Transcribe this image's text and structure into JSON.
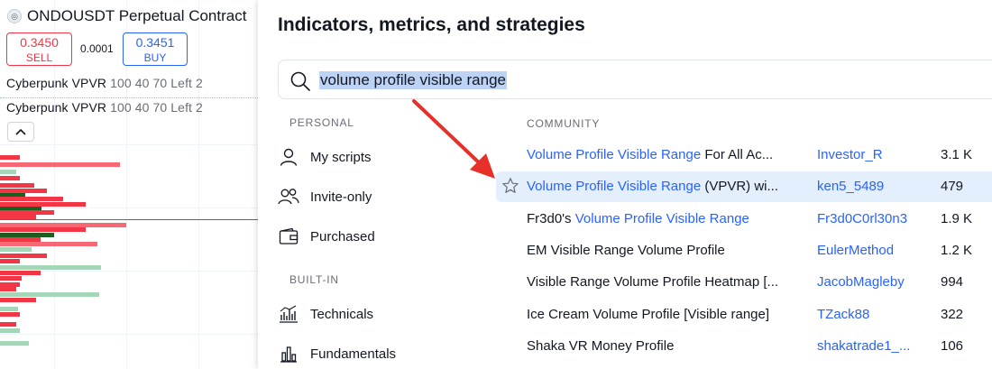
{
  "chart": {
    "symbol_title": "ONDOUSDT Perpetual Contract",
    "sell_price": "0.3450",
    "sell_label": "SELL",
    "spread": "0.0001",
    "buy_price": "0.3451",
    "buy_label": "BUY",
    "indicator_name": "Cyberpunk VPVR",
    "indicator_params": "100 40 70 Left 2",
    "collapse_icon": "chevron-up-icon",
    "colors": {
      "up": "#a5d6b7",
      "down": "#f23645",
      "line": "#e0313f"
    }
  },
  "panel": {
    "title": "Indicators, metrics, and strategies",
    "search": {
      "value": "volume profile visible range"
    },
    "sections": {
      "personal": "PERSONAL",
      "built_in": "BUILT-IN",
      "community": "COMMUNITY"
    },
    "nav": [
      {
        "label": "My scripts",
        "icon": "user-icon"
      },
      {
        "label": "Invite-only",
        "icon": "users-icon"
      },
      {
        "label": "Purchased",
        "icon": "wallet-icon"
      },
      {
        "label": "Technicals",
        "icon": "chart-bars-icon"
      },
      {
        "label": "Fundamentals",
        "icon": "bar-chart-icon"
      }
    ],
    "rows": [
      {
        "link": "Volume Profile Visible Range",
        "rest": " For All Ac...",
        "author": "Investor_R",
        "count": "3.1 K"
      },
      {
        "link": "Volume Profile Visible Range",
        "rest": " (VPVR) wi...",
        "author": "ken5_5489",
        "count": "479"
      },
      {
        "pre": "Fr3d0's ",
        "link": "Volume Profile Visible Range",
        "author": "Fr3d0C0rl30n3",
        "count": "1.9 K"
      },
      {
        "pre": "EM Visible Range Volume Profile",
        "author": "EulerMethod",
        "count": "1.2 K"
      },
      {
        "pre": "Visible Range Volume Profile Heatmap [...",
        "author": "JacobMagleby",
        "count": "994"
      },
      {
        "pre": "Ice Cream Volume Profile [Visible range]",
        "author": "TZack88",
        "count": "322"
      },
      {
        "pre": "Shaka VR Money Profile",
        "author": "shakatrade1_...",
        "count": "106"
      }
    ],
    "accent": "#2962ff",
    "highlight": "#e3effd",
    "annotation_color": "#e8302a"
  }
}
